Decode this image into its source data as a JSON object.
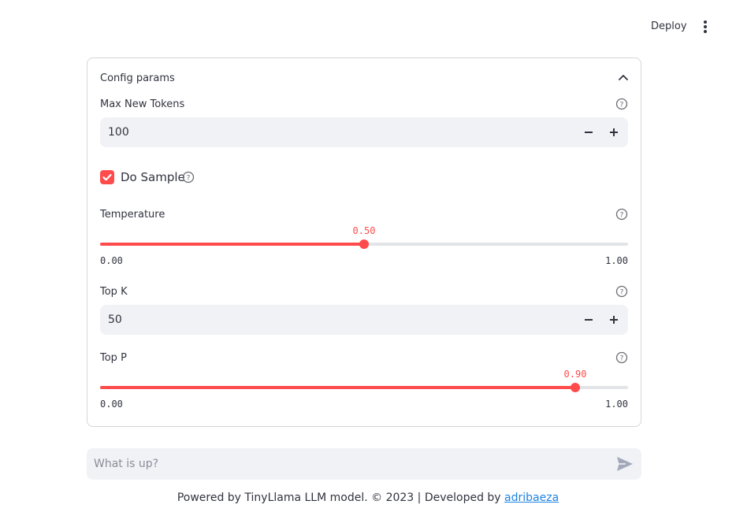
{
  "header": {
    "deploy_label": "Deploy",
    "menu_icon": "vertical-ellipsis-icon"
  },
  "config": {
    "title": "Config params",
    "max_new_tokens": {
      "label": "Max New Tokens",
      "value": "100"
    },
    "do_sample": {
      "label": "Do Sample",
      "checked": true
    },
    "temperature": {
      "label": "Temperature",
      "value": 0.5,
      "value_label": "0.50",
      "min_label": "0.00",
      "max_label": "1.00"
    },
    "top_k": {
      "label": "Top K",
      "value": "50"
    },
    "top_p": {
      "label": "Top P",
      "value": 0.9,
      "value_label": "0.90",
      "min_label": "0.00",
      "max_label": "1.00"
    }
  },
  "chat": {
    "placeholder": "What is up?"
  },
  "footer": {
    "text": "Powered by TinyLlama LLM model. © 2023 | Developed by ",
    "link_text": "adribaeza"
  },
  "colors": {
    "accent": "#ff4b4b",
    "input_bg": "#f0f2f6",
    "link": "#1c83e1"
  }
}
